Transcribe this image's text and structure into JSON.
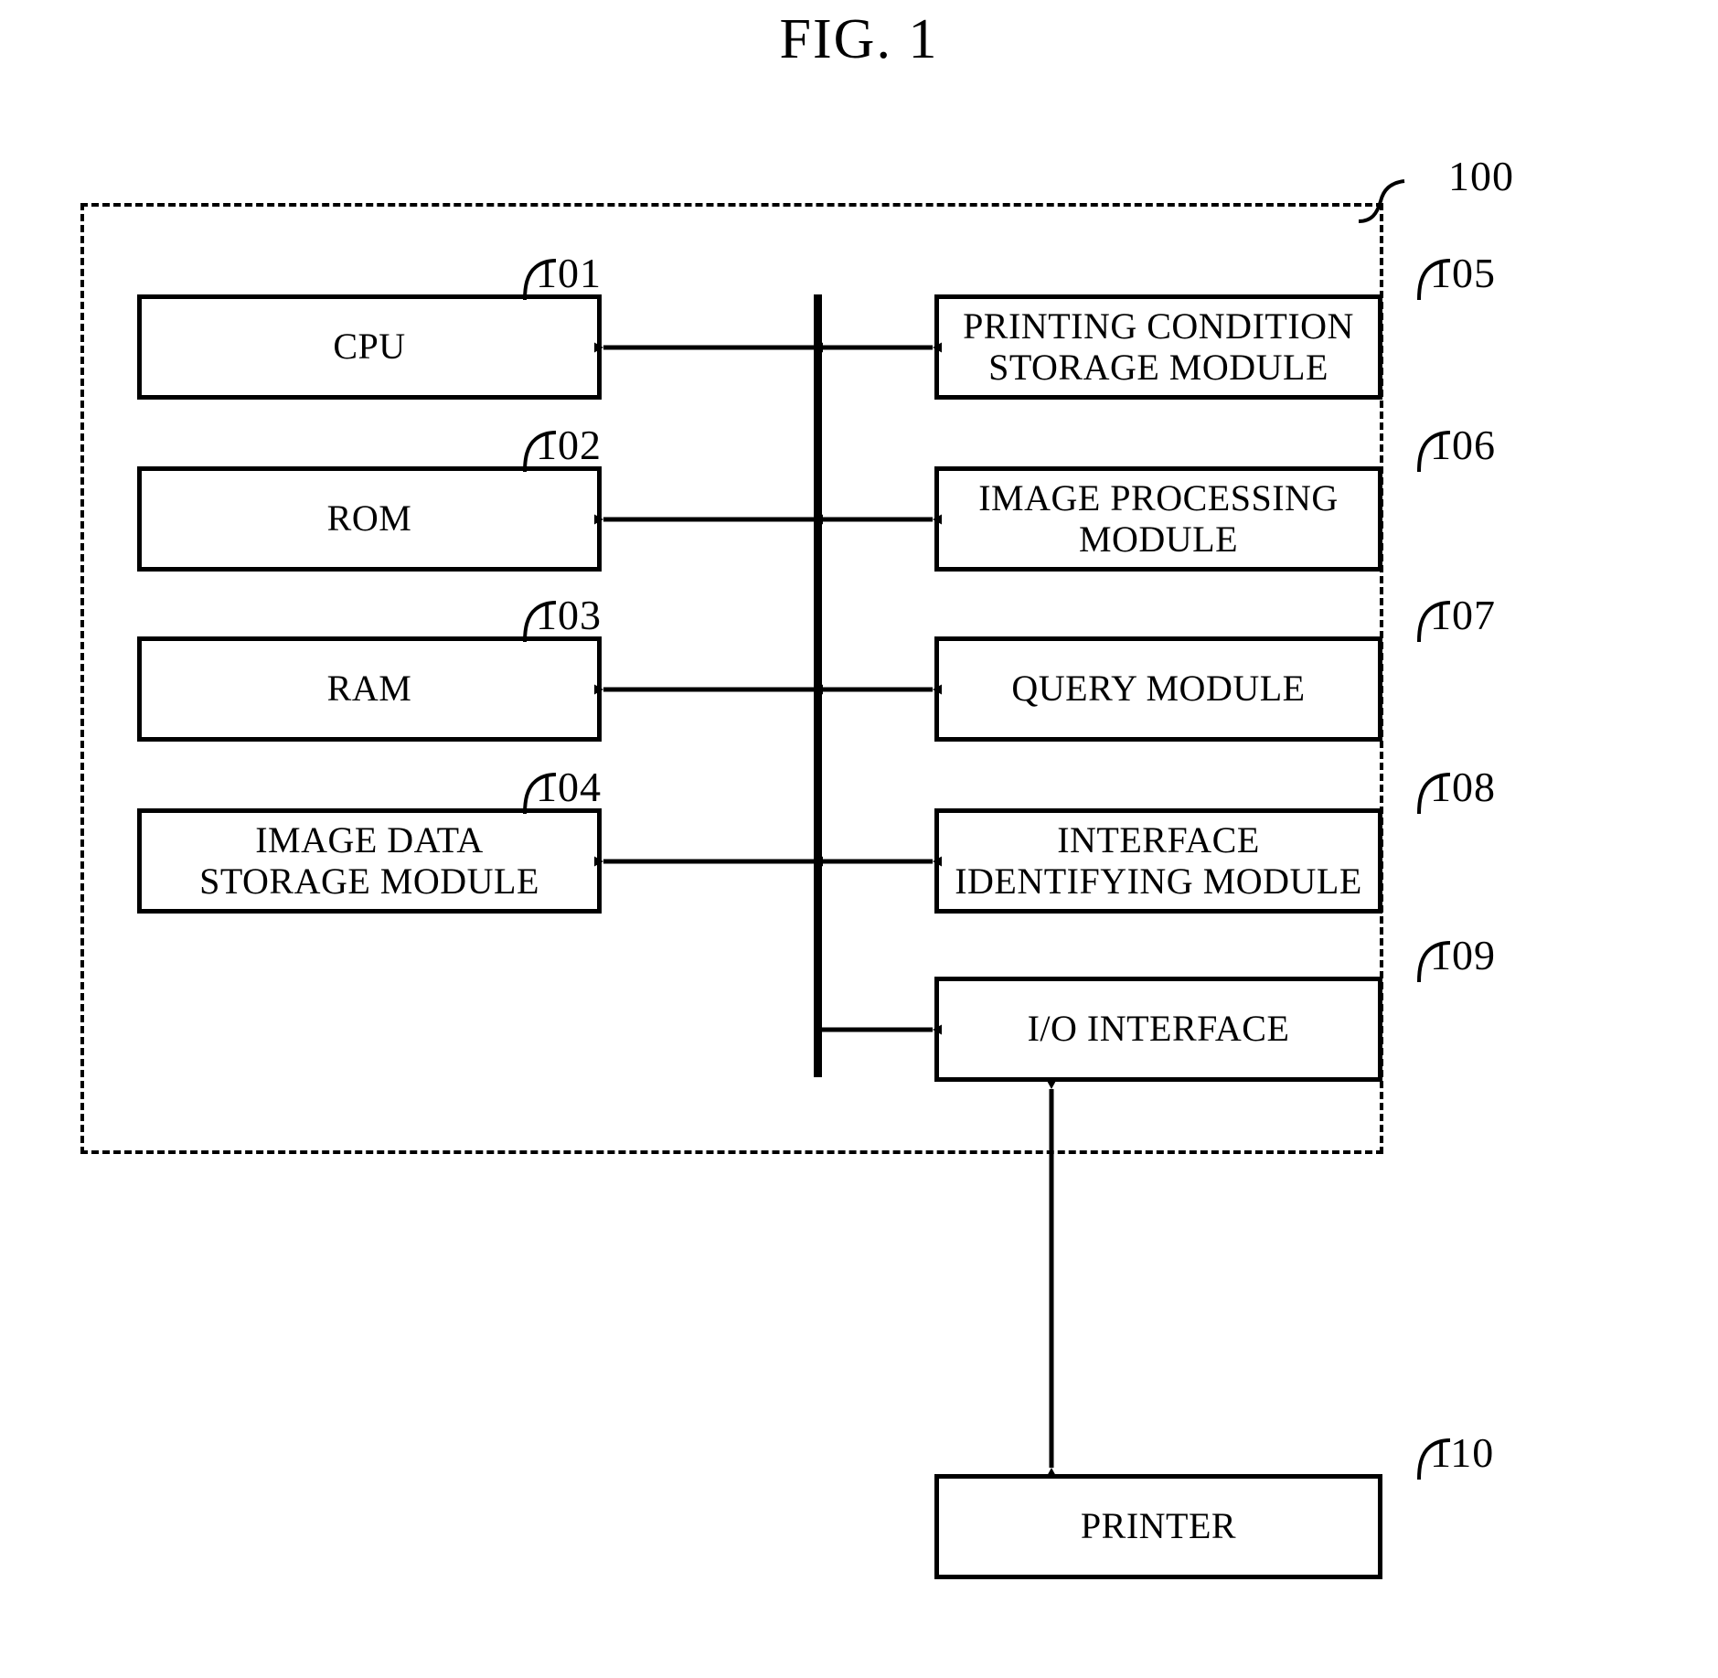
{
  "figure": {
    "title": "FIG. 1",
    "system_ref": "100"
  },
  "boxes": [
    {
      "id": "cpu",
      "ref": "101",
      "label": "CPU",
      "column": "left"
    },
    {
      "id": "rom",
      "ref": "102",
      "label": "ROM",
      "column": "left"
    },
    {
      "id": "ram",
      "ref": "103",
      "label": "RAM",
      "column": "left"
    },
    {
      "id": "image-data-storage",
      "ref": "104",
      "label": "IMAGE DATA\nSTORAGE MODULE",
      "column": "left"
    },
    {
      "id": "printing-condition-storage",
      "ref": "105",
      "label": "PRINTING CONDITION\nSTORAGE MODULE",
      "column": "right"
    },
    {
      "id": "image-processing",
      "ref": "106",
      "label": "IMAGE PROCESSING\nMODULE",
      "column": "right"
    },
    {
      "id": "query",
      "ref": "107",
      "label": "QUERY MODULE",
      "column": "right"
    },
    {
      "id": "interface-identifying",
      "ref": "108",
      "label": "INTERFACE\nIDENTIFYING MODULE",
      "column": "right"
    },
    {
      "id": "io-interface",
      "ref": "109",
      "label": "I/O INTERFACE",
      "column": "right"
    },
    {
      "id": "printer",
      "ref": "110",
      "label": "PRINTER",
      "column": "external"
    }
  ],
  "colors": {
    "line": "#000000",
    "background": "#ffffff"
  }
}
